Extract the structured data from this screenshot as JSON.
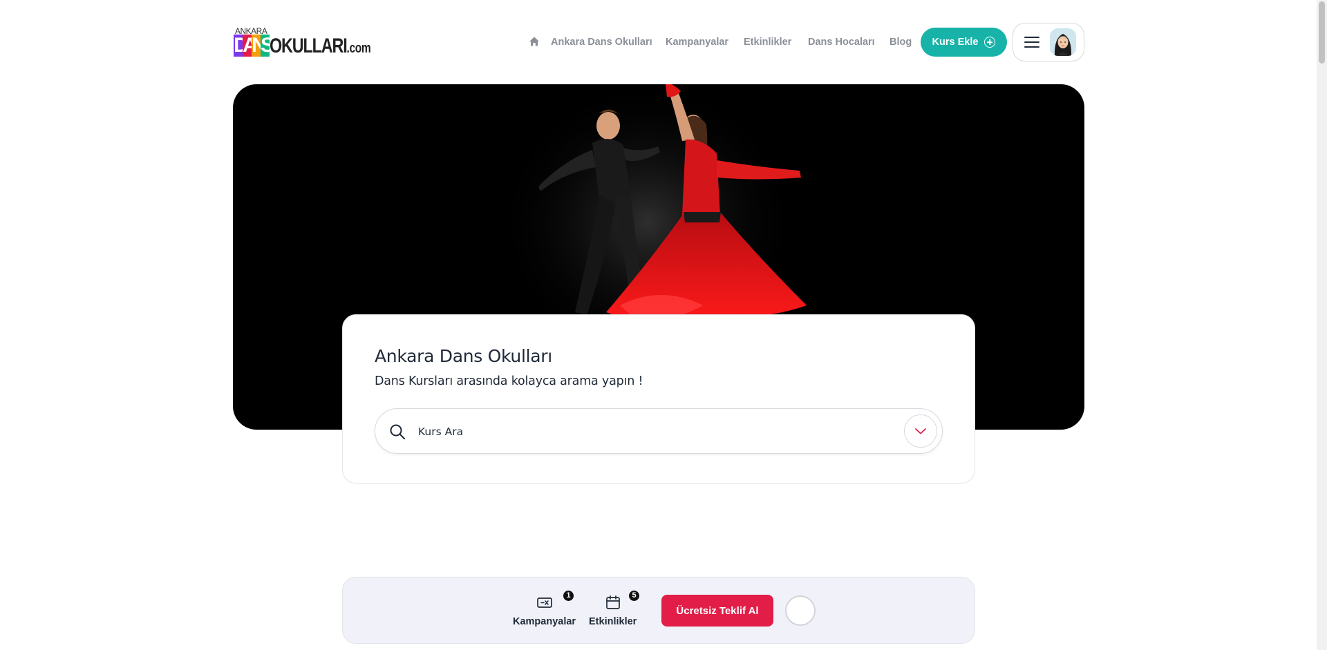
{
  "logo": {
    "top": "ANKARA",
    "dans_letters": [
      "D",
      "A",
      "N",
      "S"
    ],
    "okullari": "OKULLARI",
    "dotcom": ".com",
    "colors": [
      "#7c3aed",
      "#e11d48",
      "#f59e0b",
      "#10b981"
    ]
  },
  "nav": {
    "home_icon": "home-icon",
    "items": [
      {
        "label": "Ankara Dans Okulları"
      },
      {
        "label": "Kampanyalar"
      },
      {
        "label": "Etkinlikler"
      },
      {
        "label": "Dans Hocaları"
      },
      {
        "label": "Blog"
      }
    ],
    "cta_label": "Kurs Ekle",
    "cta_color": "#17b3a8"
  },
  "user_menu": {
    "menu_icon": "hamburger-icon",
    "avatar_icon": "avatar"
  },
  "hero": {
    "image_desc_icon": "dancers-image"
  },
  "search": {
    "title": "Ankara Dans Okulları",
    "subtitle": "Dans Kursları arasında kolayca arama yapın !",
    "placeholder": "Kurs Ara",
    "accent": "#e11d48"
  },
  "bottom_bar": {
    "items": [
      {
        "label": "Kampanyalar",
        "badge": "1",
        "icon": "ticket-icon"
      },
      {
        "label": "Etkinlikler",
        "badge": "5",
        "icon": "calendar-icon"
      }
    ],
    "cta_label": "Ücretsiz Teklif Al",
    "cta_color": "#e11d48"
  }
}
